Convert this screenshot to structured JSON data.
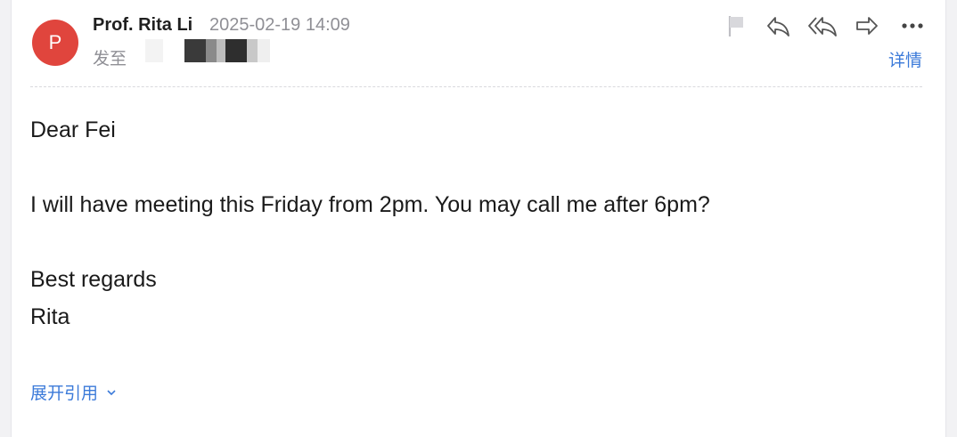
{
  "header": {
    "avatar_letter": "P",
    "avatar_color": "#e0453d",
    "sender_name": "Prof. Rita Li",
    "timestamp": "2025-02-19 14:09",
    "to_label": "发至",
    "details_label": "详情"
  },
  "toolbar": {
    "icons": [
      "flag-icon",
      "reply-icon",
      "reply-all-icon",
      "forward-icon",
      "more-icon"
    ]
  },
  "body": {
    "greeting": "Dear Fei",
    "message": "I will have meeting this Friday from 2pm. You may call me after 6pm?",
    "closing": "Best regards",
    "signature": "Rita"
  },
  "footer": {
    "expand_quote_label": "展开引用"
  },
  "colors": {
    "link": "#3b7ad9",
    "muted_text": "#8f8f95",
    "icon": "#555555"
  }
}
